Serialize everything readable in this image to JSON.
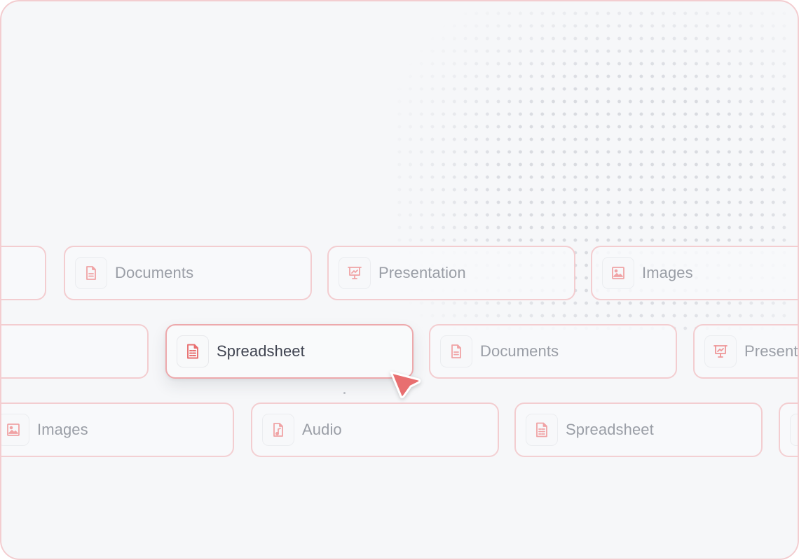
{
  "colors": {
    "accent": "#e86f70",
    "card_border": "#f3cdd0",
    "card_border_active": "#eda9ac",
    "label_muted": "#9a9ea6",
    "label_active": "#3f4350",
    "background": "#f6f7f9"
  },
  "rows": [
    {
      "cards": [
        {
          "label": "",
          "icon": "none"
        },
        {
          "label": "Documents",
          "icon": "document-icon"
        },
        {
          "label": "Presentation",
          "icon": "presentation-icon"
        },
        {
          "label": "Images",
          "icon": "image-icon"
        }
      ]
    },
    {
      "cards": [
        {
          "label": "",
          "icon": "none"
        },
        {
          "label": "Spreadsheet",
          "icon": "spreadsheet-icon",
          "active": true
        },
        {
          "label": "Documents",
          "icon": "document-icon"
        },
        {
          "label": "Presentation",
          "icon": "presentation-icon"
        }
      ]
    },
    {
      "cards": [
        {
          "label": "Images",
          "icon": "image-icon"
        },
        {
          "label": "Audio",
          "icon": "audio-file-icon"
        },
        {
          "label": "Spreadsheet",
          "icon": "spreadsheet-icon"
        },
        {
          "label": "",
          "icon": "none"
        }
      ]
    }
  ],
  "cursor": {
    "icon": "pointer-cursor-icon",
    "target": "Spreadsheet"
  }
}
